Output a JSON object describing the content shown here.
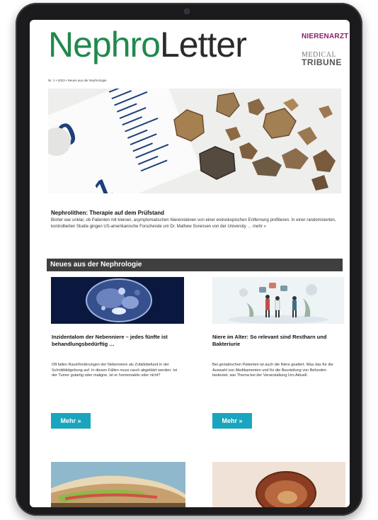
{
  "header": {
    "brand_part1": "Nephro",
    "brand_part2": "Letter",
    "partner_logo_1": "NIERENARZT",
    "partner_logo_1_mark": "✓",
    "partner_logo_2_line1": "MEDICAL",
    "partner_logo_2_line2": "TRIBUNE",
    "issue_line": "Nr. 1 • 2023 • Neues aus der Nephrologie"
  },
  "lead": {
    "title": "Nephrolithen: Therapie auf dem Prüfstand",
    "text": "Bisher war unklar, ob Patienten mit kleinen, asymptomatischen Nierensteinen von einer endoskopischen Entfernung profitieren. In einer randomisierten, kontrollierten Studie gingen US-amerikanische Forschende um Dr. Mathew Sorensen von der University … mehr »"
  },
  "section": {
    "title": "Neues aus der Nephrologie"
  },
  "articles": [
    {
      "title": "Inzidentalom der Nebenniere – jedes fünfte ist behandlungsbedürftig …",
      "text": "Oft fallen Raumforderungen der Nebenniere als Zufallsbefund in der Schnittbildgebung auf. In diesen Fällen muss rasch abgeklärt werden: Ist der Tumor gutartig oder maligne, ist er hormonaktiv oder nicht?",
      "button": "Mehr »"
    },
    {
      "title": "Niere im Alter: So relevant sind Restharn und Bakteriurie",
      "text": "Bei geriatrischen Patienten ist auch die Niere gealtert. Was das für die Auswahl von Medikamenten und für die Beurteilung von Befunden bedeutet, war Thema bei der Veranstaltung Uro Aktuell.",
      "button": "Mehr »"
    }
  ],
  "colors": {
    "brand_green": "#1f8a4c",
    "section_bar": "#3f3f3f",
    "button": "#1aa5bf"
  }
}
